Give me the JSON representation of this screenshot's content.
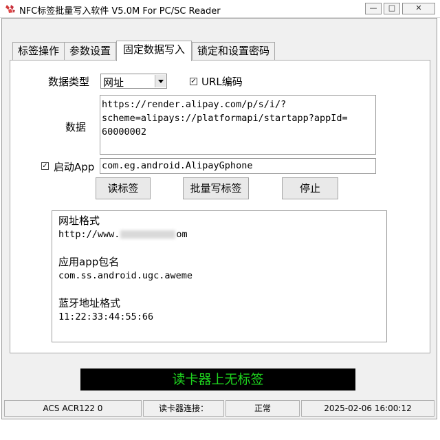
{
  "window": {
    "title": "NFC标签批量写入软件 V5.0M For PC/SC Reader",
    "minimize_icon": "minimize-icon",
    "maximize_icon": "maximize-icon",
    "close_icon": "close-icon"
  },
  "tabs": [
    {
      "label": "标签操作",
      "active": false
    },
    {
      "label": "参数设置",
      "active": false
    },
    {
      "label": "固定数据写入",
      "active": true
    },
    {
      "label": "锁定和设置密码",
      "active": false
    }
  ],
  "form": {
    "data_type_label": "数据类型",
    "data_type_value": "网址",
    "url_encode_label": "URL编码",
    "url_encode_checked": true,
    "data_label": "数据",
    "data_value": "https://render.alipay.com/p/s/i/?\nscheme=alipays://platformapi/startapp?appId=\n60000002",
    "launch_app_label": "启动App",
    "launch_app_checked": true,
    "launch_app_value": "com.eg.android.AlipayGphone"
  },
  "buttons": {
    "read": "读标签",
    "batch_write": "批量写标签",
    "stop": "停止"
  },
  "output": {
    "lines": [
      {
        "text": "网址格式",
        "mono": false
      },
      {
        "text_prefix": "http://www.",
        "text_suffix": "om",
        "mono": true,
        "redacted": true
      },
      {
        "text": "",
        "mono": false
      },
      {
        "text": "应用app包名",
        "mono": false
      },
      {
        "text": "com.ss.android.ugc.aweme",
        "mono": true
      },
      {
        "text": "",
        "mono": false
      },
      {
        "text": "蓝牙地址格式",
        "mono": false
      },
      {
        "text": "11:22:33:44:55:66",
        "mono": true
      }
    ]
  },
  "status_display": {
    "text": "读卡器上无标签",
    "color": "#1ed51e"
  },
  "statusbar": {
    "reader": "ACS ACR122 0",
    "connection_label": "读卡器连接：",
    "connection_status": "正常",
    "datetime": "2025-02-06 16:00:12"
  }
}
